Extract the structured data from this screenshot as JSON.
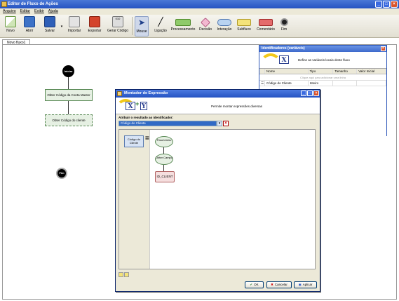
{
  "app": {
    "title": "Editor de Fluxo de Ações"
  },
  "menu": [
    "Arquivo",
    "Editar",
    "Exibir",
    "Ajuda"
  ],
  "toolbar": {
    "novo": "Novo",
    "abrir": "Abrir",
    "salvar": "Salvar",
    "importar": "Importar",
    "exportar": "Exportar",
    "gerar_codigo": "Gerar Código",
    "mouse": "Mouse",
    "ligacao": "Ligação",
    "processamento": "Processamento",
    "decisao": "Decisão",
    "interacao": "Interação",
    "subfluxo": "Subfluxo",
    "comentario": "Comentário",
    "fim": "Fim"
  },
  "document_tab": "Novo fluxo1",
  "flow": {
    "start": "Iniciar",
    "step1": "Obter Código da Conta Master",
    "step2": "Obter Código do cliente",
    "end": "Fim"
  },
  "identificadores": {
    "title": "Identificadores (variáveis)",
    "banner_text": "Define as variáveis locais deste fluxo",
    "columns": [
      "Nome",
      "Tipo",
      "Tamanho",
      "Valor Inicial"
    ],
    "placeholder_row": "Clique aqui para adicionar uma linha",
    "rows": [
      {
        "nome": "Código do Cliente",
        "tipo": "Inteiro",
        "tamanho": "",
        "valor": ""
      }
    ]
  },
  "montador": {
    "title": "Montador de Expressão",
    "banner_text": "Permite montar expressões diversas",
    "assign_label": "Atribuir o resultado ao identificador:",
    "assign_value": "Código do Cliente",
    "target_box": "Código do Cliente",
    "equals": "=",
    "expr_nodes": [
      "Para Inteiro",
      "Obter Campo",
      "ID_CLIENT"
    ],
    "ok": "OK",
    "cancel": "Cancelar",
    "apply": "Aplicar"
  }
}
